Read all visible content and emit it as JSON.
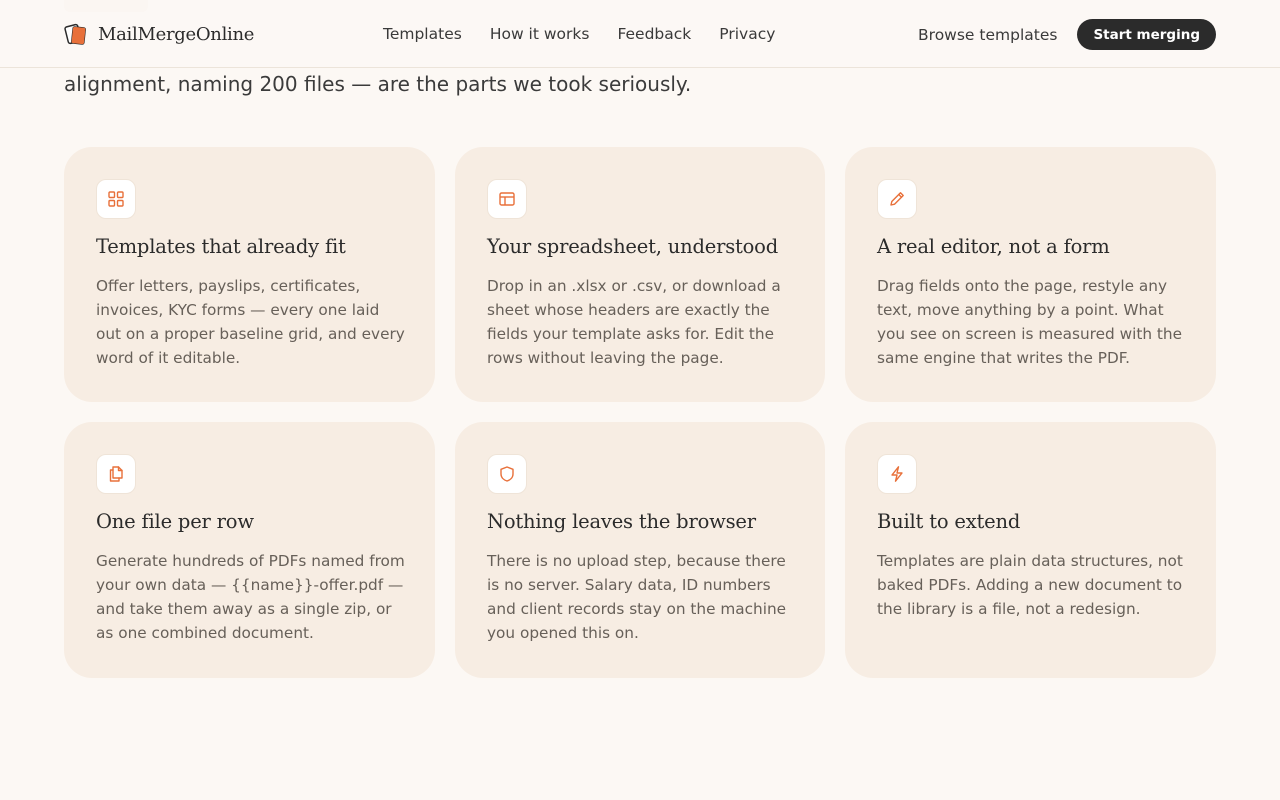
{
  "brand": {
    "name": "MailMergeOnline",
    "logo_icon": "stacked-pages-logo-icon"
  },
  "nav": {
    "items": [
      {
        "label": "Templates"
      },
      {
        "label": "How it works"
      },
      {
        "label": "Feedback"
      },
      {
        "label": "Privacy"
      }
    ]
  },
  "actions": {
    "browse_label": "Browse templates",
    "start_label": "Start merging"
  },
  "intro": {
    "line_visible": "alignment, naming 200 files — are the parts we took seriously."
  },
  "features": [
    {
      "icon": "grid-icon",
      "title": "Templates that already fit",
      "body": "Offer letters, payslips, certificates, invoices, KYC forms — every one laid out on a proper baseline grid, and every word of it editable."
    },
    {
      "icon": "table-icon",
      "title": "Your spreadsheet, understood",
      "body": "Drop in an .xlsx or .csv, or download a sheet whose headers are exactly the fields your template asks for. Edit the rows without leaving the page."
    },
    {
      "icon": "pencil-icon",
      "title": "A real editor, not a form",
      "body": "Drag fields onto the page, restyle any text, move anything by a point. What you see on screen is measured with the same engine that writes the PDF."
    },
    {
      "icon": "files-icon",
      "title": "One file per row",
      "body": "Generate hundreds of PDFs named from your own data — {{name}}-offer.pdf — and take them away as a single zip, or as one combined document."
    },
    {
      "icon": "shield-icon",
      "title": "Nothing leaves the browser",
      "body": "There is no upload step, because there is no server. Salary data, ID numbers and client records stay on the machine you opened this on."
    },
    {
      "icon": "lightning-icon",
      "title": "Built to extend",
      "body": "Templates are plain data structures, not baked PDFs. Adding a new document to the library is a file, not a redesign."
    }
  ],
  "colors": {
    "background": "#fcf8f4",
    "card": "#f7ede3",
    "accent": "#e8703a",
    "primary_button": "#2b2b2b"
  }
}
